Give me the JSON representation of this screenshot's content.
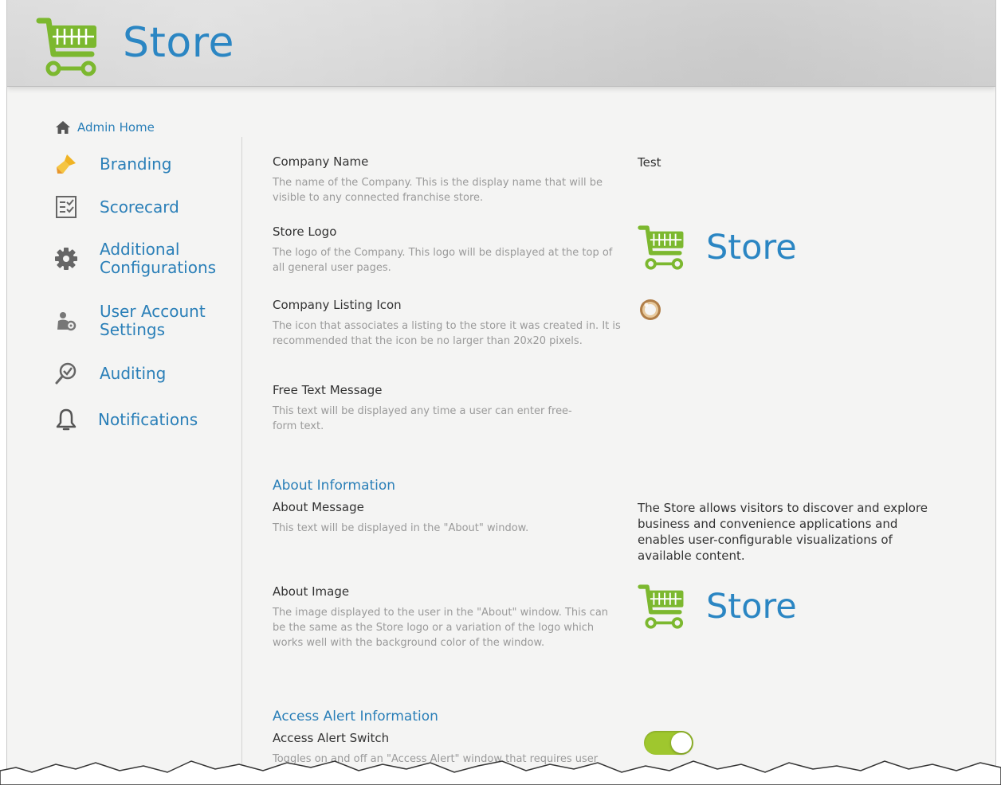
{
  "header": {
    "logo_text": "Store"
  },
  "nav": {
    "admin_home": "Admin Home",
    "items": [
      {
        "label": "Branding",
        "icon": "paintbrush-icon"
      },
      {
        "label": "Scorecard",
        "icon": "scorecard-checklist-icon"
      },
      {
        "label": "Additional\nConfigurations",
        "icon": "gear-icon"
      },
      {
        "label": "User Account\nSettings",
        "icon": "user-settings-icon"
      },
      {
        "label": "Auditing",
        "icon": "magnifier-check-icon"
      },
      {
        "label": "Notifications",
        "icon": "bell-icon"
      }
    ]
  },
  "fields": {
    "company_name": {
      "title": "Company Name",
      "desc": "The name of the Company. This is the display name that will be visible to any connected franchise store.",
      "value": "Test"
    },
    "store_logo": {
      "title": "Store Logo",
      "desc": "The logo of the Company. This logo will be displayed at the top of all general user pages.",
      "logo_text": "Store"
    },
    "listing_icon": {
      "title": "Company Listing Icon",
      "desc": "The icon that associates a listing to the store it was created in. It is recommended that the icon be no larger than 20x20 pixels."
    },
    "free_text": {
      "title": "Free Text Message",
      "desc": "This text will be displayed any time a user can enter free-form text."
    }
  },
  "about": {
    "section_title": "About Information",
    "message_title": "About Message",
    "message_desc": "This text will be displayed in the \"About\" window.",
    "message_value": "The Store allows visitors to discover and explore business and convenience applications and enables user-configurable visualizations of available content.",
    "image_title": "About Image",
    "image_desc": "The image displayed to the user in the \"About\" window. This can be the same as the Store logo or a variation of the logo which works well with the background color of the window.",
    "image_logo_text": "Store"
  },
  "access_alert": {
    "section_title": "Access Alert Information",
    "switch_title": "Access Alert Switch",
    "switch_desc": "Toggles on and off an \"Access Alert\" window that requires user acknowledgement before allowing access to the",
    "switch_on": true
  },
  "colors": {
    "accent_blue": "#2a7fb8",
    "cart_green": "#7cb82f",
    "toggle_green": "#9fc72e"
  }
}
